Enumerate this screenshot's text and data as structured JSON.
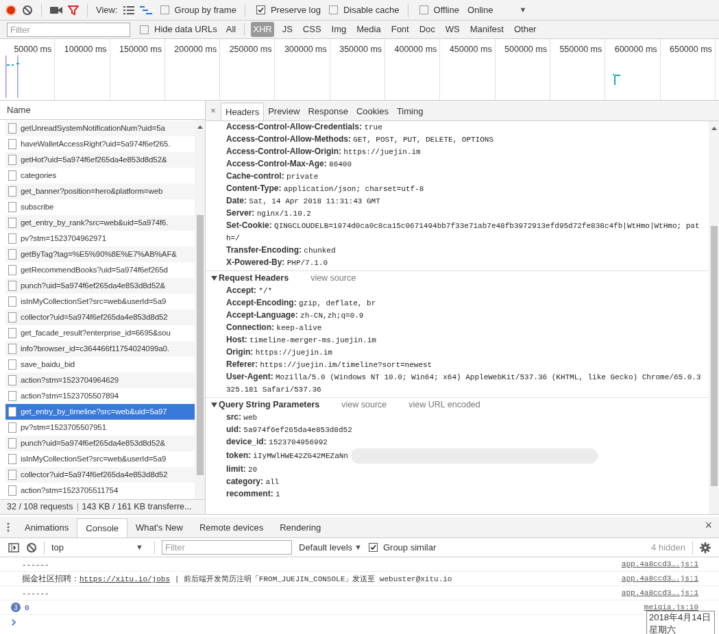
{
  "toolbar": {
    "view_label": "View:",
    "checkboxes": [
      {
        "label": "Group by frame",
        "checked": false
      },
      {
        "label": "Preserve log",
        "checked": true
      },
      {
        "label": "Disable cache",
        "checked": false
      },
      {
        "label": "Offline",
        "checked": false
      }
    ],
    "throttle": "Online",
    "caret": "▼"
  },
  "filter_bar": {
    "placeholder": "Filter",
    "hide_data_urls": {
      "label": "Hide data URLs",
      "checked": false
    },
    "types": [
      {
        "label": "All",
        "selected": false
      },
      {
        "label": "XHR",
        "selected": true
      },
      {
        "label": "JS",
        "selected": false
      },
      {
        "label": "CSS",
        "selected": false
      },
      {
        "label": "Img",
        "selected": false
      },
      {
        "label": "Media",
        "selected": false
      },
      {
        "label": "Font",
        "selected": false
      },
      {
        "label": "Doc",
        "selected": false
      },
      {
        "label": "WS",
        "selected": false
      },
      {
        "label": "Manifest",
        "selected": false
      },
      {
        "label": "Other",
        "selected": false
      }
    ]
  },
  "timeline": {
    "ticks": [
      "50000 ms",
      "100000 ms",
      "150000 ms",
      "200000 ms",
      "250000 ms",
      "300000 ms",
      "350000 ms",
      "400000 ms",
      "450000 ms",
      "500000 ms",
      "550000 ms",
      "600000 ms",
      "650000 ms"
    ]
  },
  "requests": {
    "column": "Name",
    "rows": [
      {
        "name": "getUnreadSystemNotificationNum?uid=5a",
        "selected": false
      },
      {
        "name": "haveWalletAccessRight?uid=5a974f6ef265.",
        "selected": false
      },
      {
        "name": "getHot?uid=5a974f6ef265da4e853d8d52&",
        "selected": false
      },
      {
        "name": "categories",
        "selected": false
      },
      {
        "name": "get_banner?position=hero&platform=web",
        "selected": false
      },
      {
        "name": "subscribe",
        "selected": false
      },
      {
        "name": "get_entry_by_rank?src=web&uid=5a974f6.",
        "selected": false
      },
      {
        "name": "pv?stm=1523704962971",
        "selected": false
      },
      {
        "name": "getByTag?tag=%E5%90%8E%E7%AB%AF&",
        "selected": false
      },
      {
        "name": "getRecommendBooks?uid=5a974f6ef265d",
        "selected": false
      },
      {
        "name": "punch?uid=5a974f6ef265da4e853d8d52&",
        "selected": false
      },
      {
        "name": "isInMyCollectionSet?src=web&userId=5a9",
        "selected": false
      },
      {
        "name": "collector?uid=5a974f6ef265da4e853d8d52",
        "selected": false
      },
      {
        "name": "get_facade_result?enterprise_id=6695&sou",
        "selected": false
      },
      {
        "name": "info?browser_id=c364466f11754024099a0.",
        "selected": false
      },
      {
        "name": "save_baidu_bid",
        "selected": false
      },
      {
        "name": "action?stm=1523704964629",
        "selected": false
      },
      {
        "name": "action?stm=1523705507894",
        "selected": false
      },
      {
        "name": "get_entry_by_timeline?src=web&uid=5a97",
        "selected": true
      },
      {
        "name": "pv?stm=1523705507951",
        "selected": false
      },
      {
        "name": "punch?uid=5a974f6ef265da4e853d8d52&",
        "selected": false
      },
      {
        "name": "isInMyCollectionSet?src=web&userId=5a9",
        "selected": false
      },
      {
        "name": "collector?uid=5a974f6ef265da4e853d8d52",
        "selected": false
      },
      {
        "name": "action?stm=1523705511754",
        "selected": false
      }
    ],
    "summary": "32 / 108 requests",
    "transferred": "143 KB / 161 KB transferre..."
  },
  "detail": {
    "close": "×",
    "tabs": [
      {
        "label": "Headers",
        "selected": true
      },
      {
        "label": "Preview",
        "selected": false
      },
      {
        "label": "Response",
        "selected": false
      },
      {
        "label": "Cookies",
        "selected": false
      },
      {
        "label": "Timing",
        "selected": false
      }
    ],
    "response_headers": [
      {
        "name": "Access-Control-Allow-Credentials:",
        "value": "true"
      },
      {
        "name": "Access-Control-Allow-Methods:",
        "value": "GET, POST, PUT, DELETE, OPTIONS"
      },
      {
        "name": "Access-Control-Allow-Origin:",
        "value": "https://juejin.im"
      },
      {
        "name": "Access-Control-Max-Age:",
        "value": "86400"
      },
      {
        "name": "Cache-control:",
        "value": "private"
      },
      {
        "name": "Content-Type:",
        "value": "application/json; charset=utf-8"
      },
      {
        "name": "Date:",
        "value": "Sat, 14 Apr 2018 11:31:43 GMT"
      },
      {
        "name": "Server:",
        "value": "nginx/1.10.2"
      },
      {
        "name": "Set-Cookie:",
        "value": "QINGCLOUDELB=1974d0ca0c8ca15c0671494bb7f33e71ab7e48fb3972913efd95d72fe838c4fb|WtHmo|WtHmo; path=/"
      },
      {
        "name": "Transfer-Encoding:",
        "value": "chunked"
      },
      {
        "name": "X-Powered-By:",
        "value": "PHP/7.1.0"
      }
    ],
    "sections": [
      {
        "title": "Request Headers",
        "expanded": true,
        "links": [
          "view source"
        ],
        "items": [
          {
            "name": "Accept:",
            "value": "*/*"
          },
          {
            "name": "Accept-Encoding:",
            "value": "gzip, deflate, br"
          },
          {
            "name": "Accept-Language:",
            "value": "zh-CN,zh;q=0.9"
          },
          {
            "name": "Connection:",
            "value": "keep-alive"
          },
          {
            "name": "Host:",
            "value": "timeline-merger-ms.juejin.im"
          },
          {
            "name": "Origin:",
            "value": "https://juejin.im"
          },
          {
            "name": "Referer:",
            "value": "https://juejin.im/timeline?sort=newest"
          },
          {
            "name": "User-Agent:",
            "value": "Mozilla/5.0 (Windows NT 10.0; Win64; x64) AppleWebKit/537.36 (KHTML, like Gecko) Chrome/65.0.3325.181 Safari/537.36"
          }
        ]
      },
      {
        "title": "Query String Parameters",
        "expanded": true,
        "links": [
          "view source",
          "view URL encoded"
        ],
        "items": [
          {
            "name": "src:",
            "value": "web"
          },
          {
            "name": "uid:",
            "value": "5a974f6ef265da4e853d8d52"
          },
          {
            "name": "device_id:",
            "value": "1523704956992"
          },
          {
            "name": "token:",
            "value": "iIyMWlHWE42ZG42MEZaNn",
            "redacted": true
          },
          {
            "name": "limit:",
            "value": "20"
          },
          {
            "name": "category:",
            "value": "all"
          },
          {
            "name": "recomment:",
            "value": "1"
          }
        ]
      }
    ]
  },
  "drawer": {
    "tabs": [
      {
        "label": "Animations",
        "selected": false
      },
      {
        "label": "Console",
        "selected": true
      },
      {
        "label": "What's New",
        "selected": false
      },
      {
        "label": "Remote devices",
        "selected": false
      },
      {
        "label": "Rendering",
        "selected": false
      }
    ],
    "close": "×",
    "context": "top",
    "filter_placeholder": "Filter",
    "levels": "Default levels",
    "levels_caret": "▼",
    "group_similar": {
      "label": "Group similar",
      "checked": true
    },
    "hidden": "4 hidden",
    "messages": [
      {
        "kind": "plain",
        "parts": [
          {
            "kind": "text",
            "text": "------"
          }
        ],
        "source": "app.4a8ccd3….js:1"
      },
      {
        "kind": "plain",
        "parts": [
          {
            "kind": "text",
            "text": "掘金社区招聘："
          },
          {
            "kind": "link",
            "text": "https://xitu.io/jobs"
          },
          {
            "kind": "text",
            "text": " | 前后端开发简历注明「FROM_JUEJIN_CONSOLE」发送至 webuster@xitu.io"
          }
        ],
        "source": "app.4a8ccd3….js:1"
      },
      {
        "kind": "plain",
        "parts": [
          {
            "kind": "text",
            "text": "------"
          }
        ],
        "source": "app.4a8ccd3….js:1"
      },
      {
        "kind": "grouped",
        "count": "3",
        "parts": [
          {
            "kind": "number",
            "text": "0"
          }
        ],
        "source": "meiqia.js:10"
      }
    ],
    "tooltip": [
      "2018年4月14日",
      "星期六"
    ]
  }
}
